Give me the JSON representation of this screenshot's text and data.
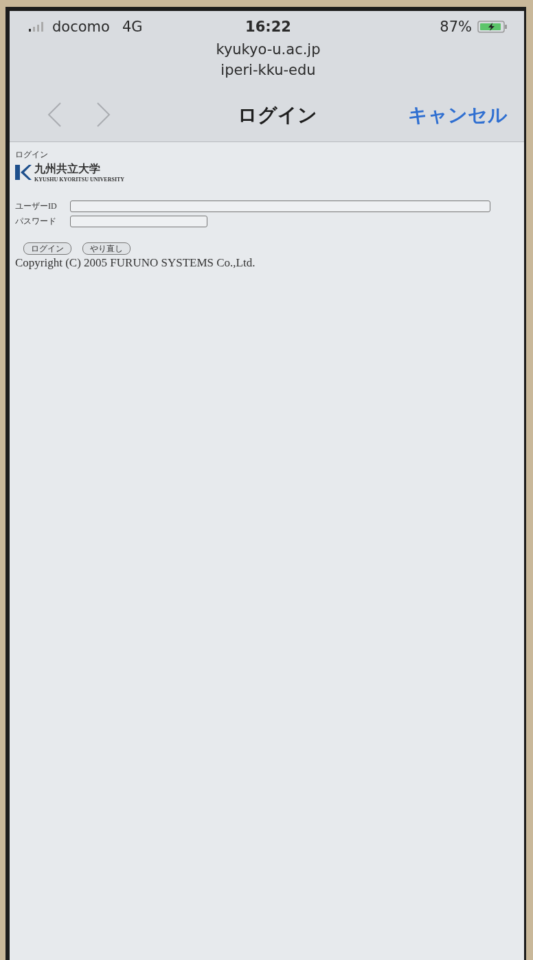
{
  "status_bar": {
    "carrier": "docomo",
    "network": "4G",
    "time": "16:22",
    "battery": "87%",
    "charging": true
  },
  "address": {
    "domain": "kyukyo-u.ac.jp",
    "subtitle": "iperi-kku-edu"
  },
  "nav": {
    "back_disabled": true,
    "forward_disabled": true,
    "title": "ログイン",
    "cancel": "キャンセル"
  },
  "page": {
    "heading": "ログイン",
    "logo": {
      "name": "九州共立大学",
      "subtitle": "KYUSHU KYORITSU UNIVERSITY"
    },
    "fields": [
      {
        "label": "ユーザーID",
        "kind": "wide"
      },
      {
        "label": "パスワード",
        "kind": "short"
      }
    ],
    "buttons": [
      "ログイン",
      "やり直し"
    ],
    "copyright": "Copyright (C) 2005 FURUNO SYSTEMS Co.,Ltd."
  }
}
